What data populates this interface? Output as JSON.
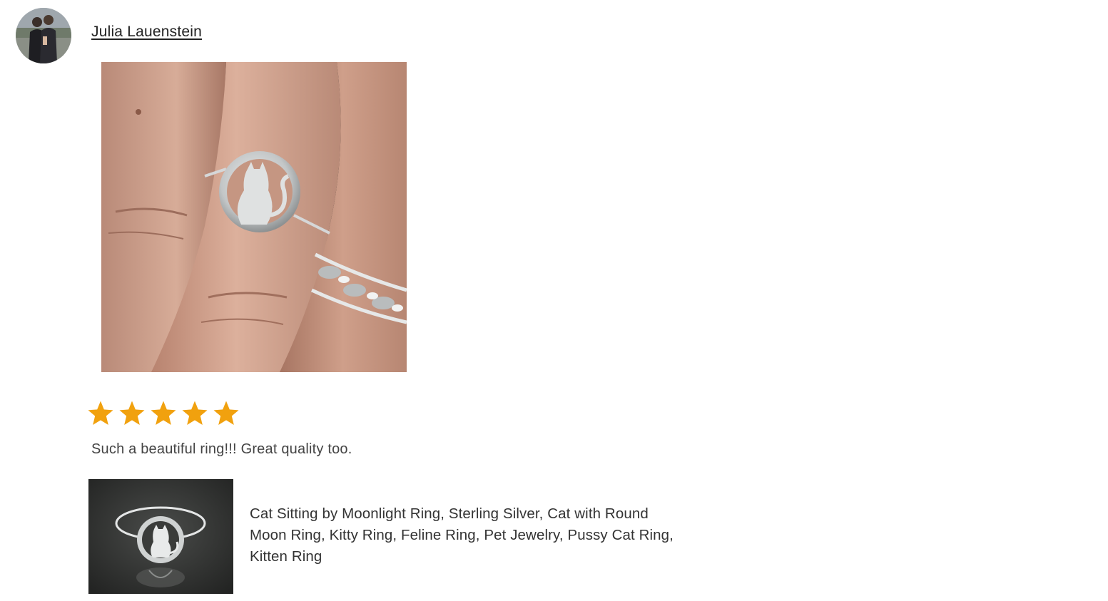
{
  "review": {
    "reviewer_name": "Julia Lauenstein",
    "avatar_icon": "reviewer-avatar-photo",
    "photo_icon": "review-photo-ring-on-finger",
    "rating": 5,
    "rating_max": 5,
    "star_color": "#f1a10e",
    "text": "Such a beautiful ring!!! Great quality too."
  },
  "product": {
    "thumbnail_icon": "product-thumbnail-ring",
    "title": "Cat Sitting by Moonlight Ring, Sterling Silver, Cat with Round Moon Ring, Kitty Ring, Feline Ring, Pet Jewelry, Pussy Cat Ring, Kitten Ring"
  }
}
